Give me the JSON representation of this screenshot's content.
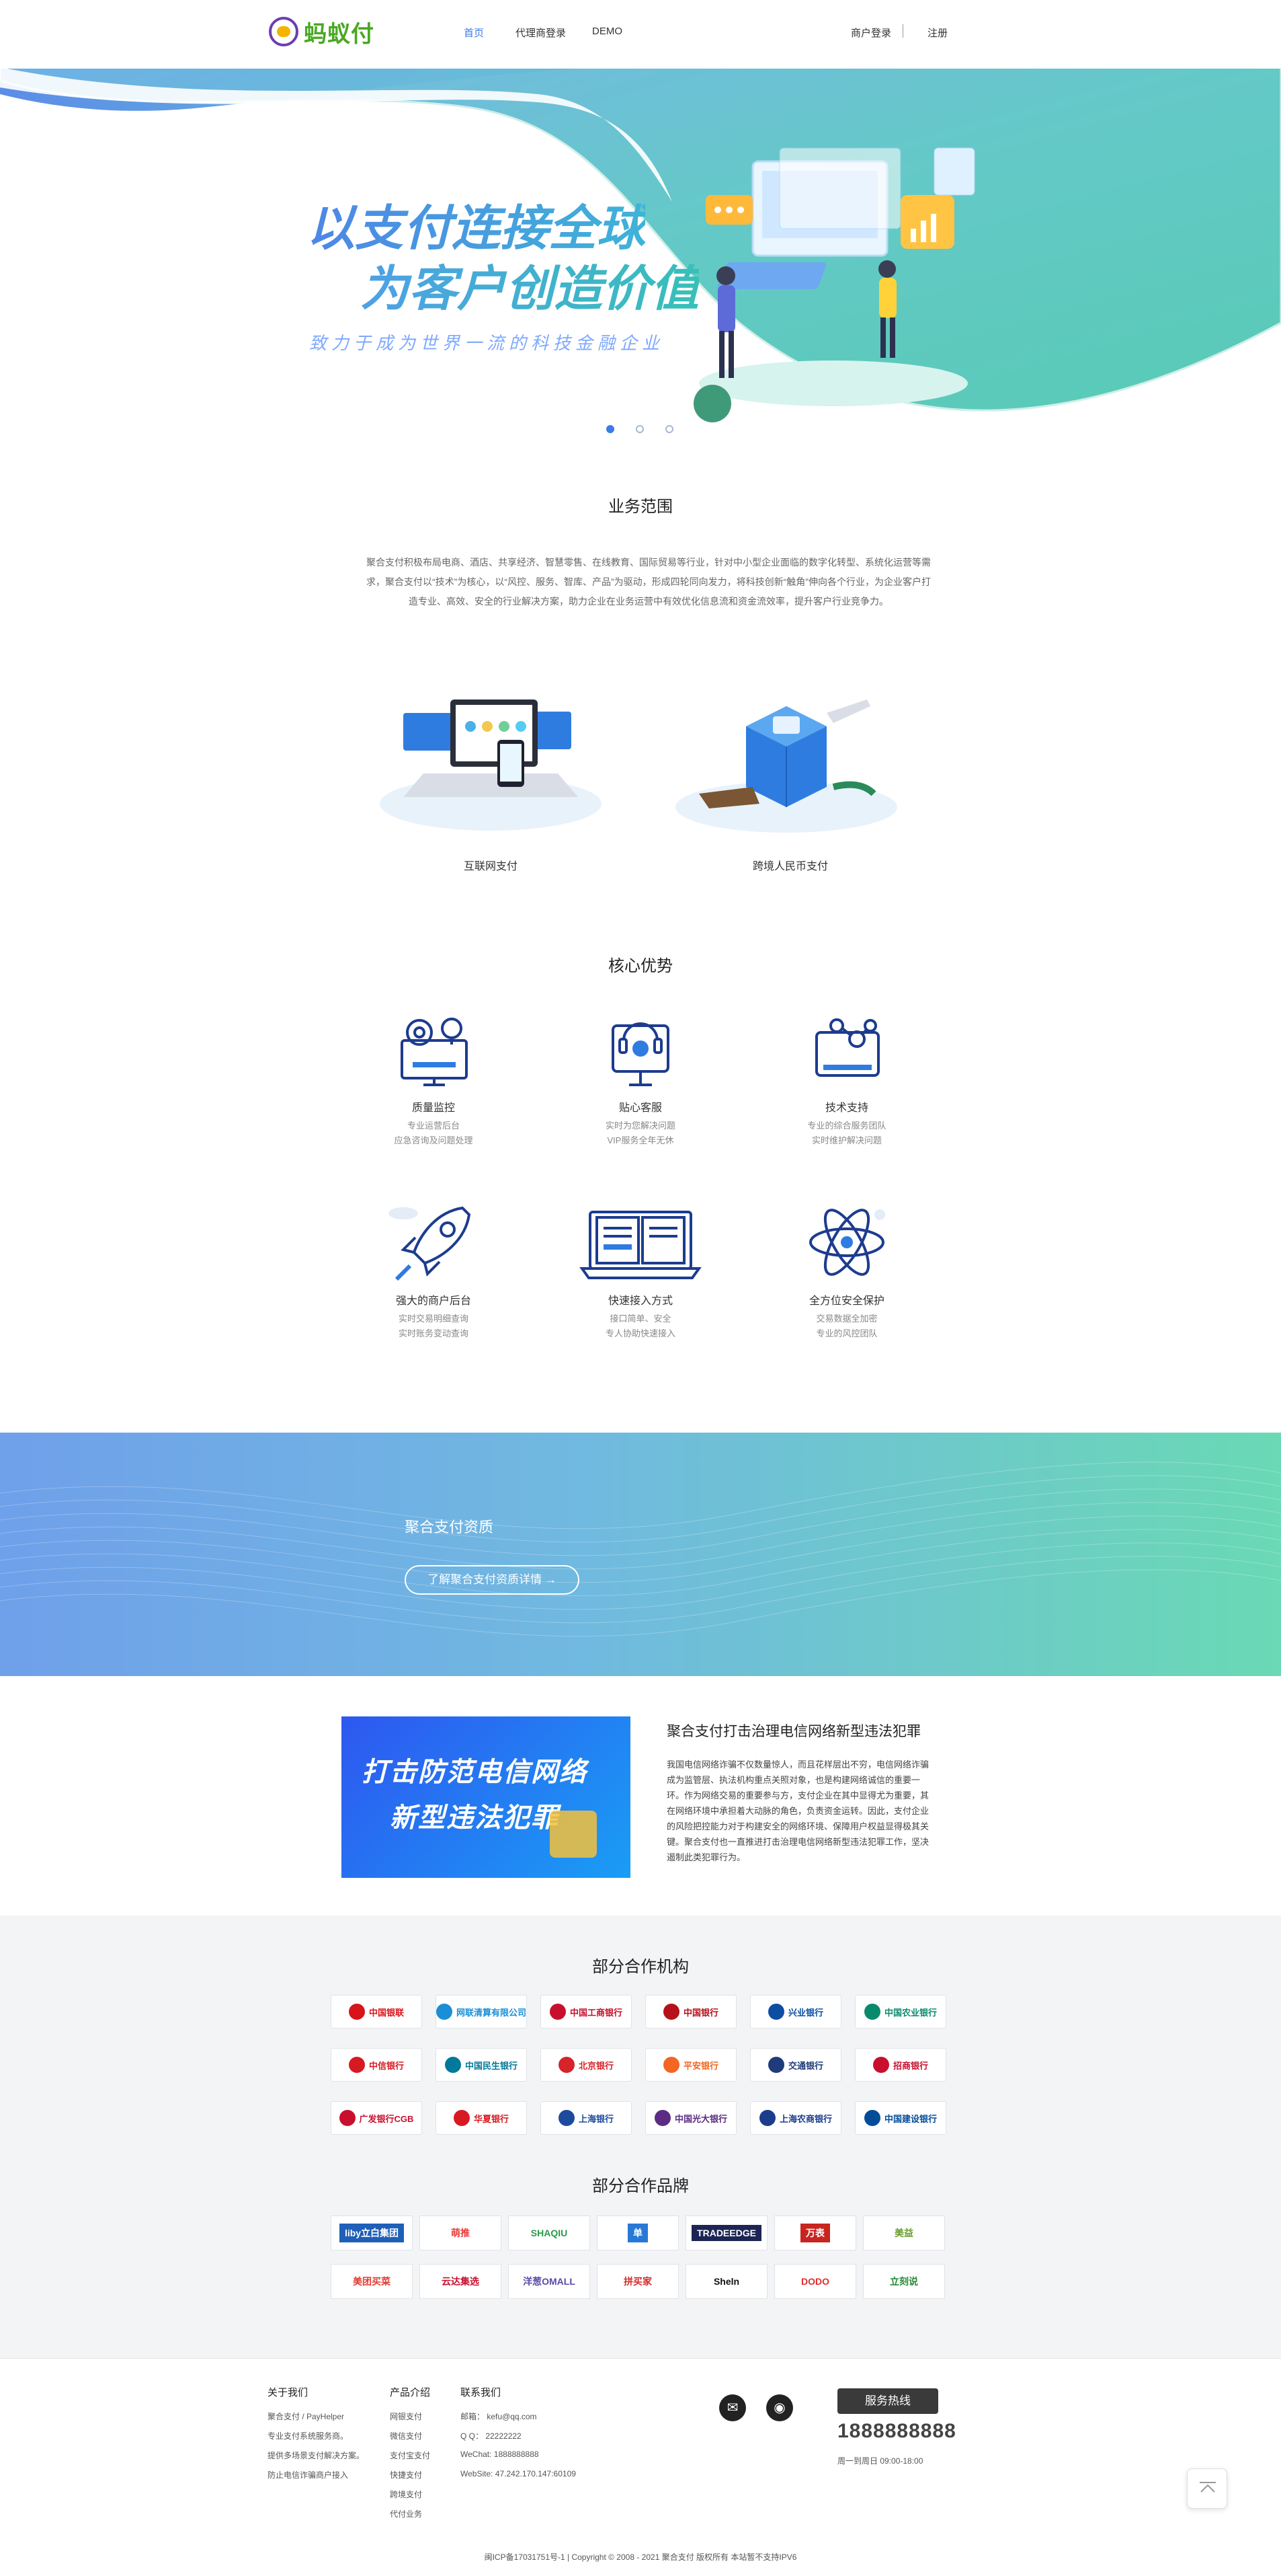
{
  "header": {
    "logo_text": "蚂蚁付",
    "nav": [
      "首页",
      "代理商登录",
      "DEMO"
    ],
    "merchant_login": "商户登录",
    "register": "注册"
  },
  "hero": {
    "title_line1": "以支付连接全球",
    "title_line2": "为客户创造价值",
    "subtitle": "致力于成为世界一流的科技金融企业",
    "slides": 3,
    "active_slide": 1
  },
  "business": {
    "title": "业务范围",
    "description": "聚合支付积极布局电商、酒店、共享经济、智慧零售、在线教育、国际贸易等行业，针对中小型企业面临的数字化转型、系统化运营等需求，聚合支付以“技术”为核心，以“风控、服务、智库、产品”为驱动，形成四轮同向发力，将科技创新“触角”伸向各个行业，为企业客户打造专业、高效、安全的行业解决方案，助力企业在业务运营中有效优化信息流和资金流效率，提升客户行业竞争力。",
    "services": [
      "互联网支付",
      "跨境人民币支付"
    ]
  },
  "advantages": {
    "title": "核心优势",
    "items": [
      {
        "icon": "monitor-gear-icon",
        "title": "质量监控",
        "line1": "专业运营后台",
        "line2": "应急咨询及问题处理"
      },
      {
        "icon": "customer-service-icon",
        "title": "贴心客服",
        "line1": "实时为您解决问题",
        "line2": "VIP服务全年无休"
      },
      {
        "icon": "tech-support-icon",
        "title": "技术支持",
        "line1": "专业的综合服务团队",
        "line2": "实时维护解决问题"
      },
      {
        "icon": "rocket-icon",
        "title": "强大的商户后台",
        "line1": "实时交易明细查询",
        "line2": "实时账务变动查询"
      },
      {
        "icon": "book-laptop-icon",
        "title": "快速接入方式",
        "line1": "接口简单、安全",
        "line2": "专人协助快速接入"
      },
      {
        "icon": "atom-icon",
        "title": "全方位安全保护",
        "line1": "交易数据全加密",
        "line2": "专业的风控团队"
      }
    ]
  },
  "qualification": {
    "title": "聚合支付资质",
    "button": "了解聚合支付资质详情 →"
  },
  "news": {
    "image_line1": "打击防范电信网络",
    "image_line2": "新型违法犯罪",
    "title": "聚合支付打击治理电信网络新型违法犯罪",
    "body": "我国电信网络诈骗不仅数量惊人，而且花样层出不穷，电信网络诈骗成为监管层、执法机构重点关照对象，也是构建网络诚信的重要一环。作为网络交易的重要参与方，支付企业在其中显得尤为重要，其在网络环境中承担着大动脉的角色，负责资金运转。因此，支付企业的风险把控能力对于构建安全的网络环境、保障用户权益显得极其关键。聚合支付也一直推进打击治理电信网络新型违法犯罪工作，坚决遏制此类犯罪行为。"
  },
  "partners": {
    "institutions_title": "部分合作机构",
    "institutions": [
      [
        "中国银联",
        "#d7141a"
      ],
      [
        "网联清算有限公司",
        "#1a8fd6"
      ],
      [
        "中国工商银行",
        "#c8102e"
      ],
      [
        "中国银行",
        "#b5121b"
      ],
      [
        "兴业银行",
        "#0d4ea3"
      ],
      [
        "中国农业银行",
        "#0a8a6d"
      ],
      [
        "中信银行",
        "#d71a21"
      ],
      [
        "中国民生银行",
        "#00799a"
      ],
      [
        "北京银行",
        "#d5242a"
      ],
      [
        "平安银行",
        "#f26522"
      ],
      [
        "交通银行",
        "#1f3b7a"
      ],
      [
        "招商银行",
        "#c8102e"
      ],
      [
        "广发银行CGB",
        "#c8102e"
      ],
      [
        "华夏银行",
        "#d71a21"
      ],
      [
        "上海银行",
        "#1c4a9c"
      ],
      [
        "中国光大银行",
        "#5b2c83"
      ],
      [
        "上海农商银行",
        "#1b3c8c"
      ],
      [
        "中国建设银行",
        "#004c99"
      ]
    ],
    "brands_title": "部分合作品牌",
    "brands": [
      [
        "liby立白集团",
        "#1f5fb8",
        "#fff"
      ],
      [
        "萌推",
        "#fff",
        "#e83b3b"
      ],
      [
        "SHAQIU",
        "#fff",
        "#2b9a4b"
      ],
      [
        "单",
        "#2878d6",
        "#fff"
      ],
      [
        "TRADEEDGE",
        "#1d2554",
        "#fff"
      ],
      [
        "万表",
        "#c8251f",
        "#fff"
      ],
      [
        "美益",
        "#fff",
        "#6a9d2f"
      ],
      [
        "美团买菜",
        "#fff",
        "#e03c31"
      ],
      [
        "云达集选",
        "#fff",
        "#c8102e"
      ],
      [
        "洋葱OMALL",
        "#fff",
        "#5a4aa6"
      ],
      [
        "拼买家",
        "#fff",
        "#d82b2b"
      ],
      [
        "Sheln",
        "#fff",
        "#111"
      ],
      [
        "DODO",
        "#fff",
        "#e02e2e"
      ],
      [
        "立刻说",
        "#fff",
        "#2a8a3a"
      ]
    ]
  },
  "footer": {
    "about_title": "关于我们",
    "about_items": [
      "聚合支付 / PayHelper",
      "专业支付系统服务商。",
      "提供多场景支付解决方案。",
      "防止电信诈骗商户接入"
    ],
    "products_title": "产品介绍",
    "products_items": [
      "网银支付",
      "微信支付",
      "支付宝支付",
      "快捷支付",
      "跨境支付",
      "代付业务"
    ],
    "contact_title": "联系我们",
    "contact_items": [
      "邮箱：  kefu@qq.com",
      "Q Q：  22222222",
      "WeChat:  1888888888",
      "WebSite:  47.242.170.147:60109"
    ],
    "hotline_label": "服务热线",
    "phone": "1888888888",
    "hours": "周一到周日  09:00-18:00",
    "copyright": "闽ICP备17031751号-1  |  Copyright © 2008 - 2021 聚合支付 版权所有 本站暂不支持IPV6"
  },
  "colors": {
    "accent": "#3c7be8",
    "icon_blue": "#1d3c8f",
    "teal": "#5fc9b8",
    "partners_bg": "#f3f4f6"
  }
}
